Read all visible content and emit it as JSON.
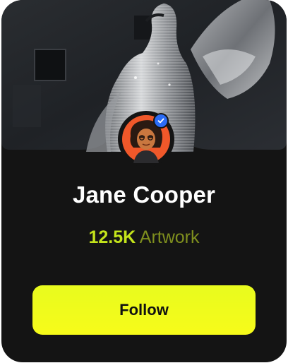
{
  "profile": {
    "name": "Jane Cooper",
    "artwork_count": "12.5K",
    "artwork_label": "Artwork",
    "verified": true
  },
  "actions": {
    "follow_label": "Follow"
  },
  "colors": {
    "card_bg": "#141414",
    "accent": "#c4e41b",
    "accent_muted": "#7f8f1e",
    "button": "#eefb1c",
    "verified_badge": "#2b6cf6",
    "avatar_bg": "#f0582a"
  },
  "icons": {
    "verified": "check-badge-icon"
  }
}
